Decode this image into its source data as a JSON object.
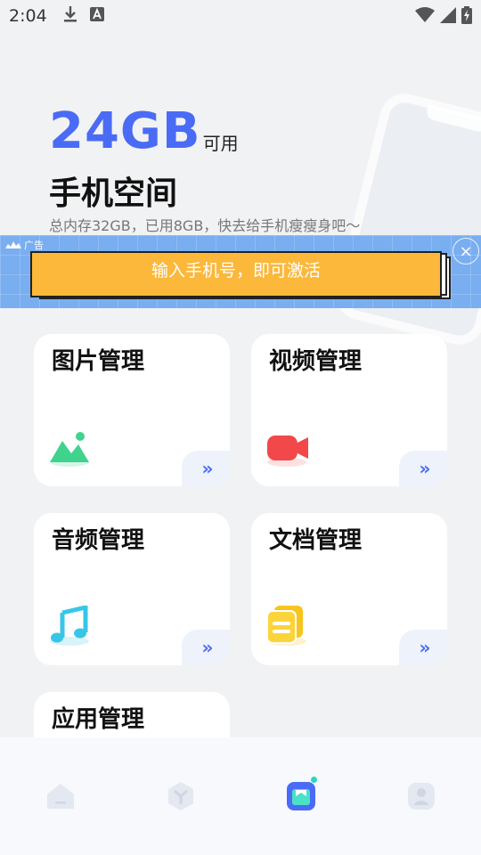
{
  "status_bar": {
    "time": "2:04",
    "icons": [
      "download-icon",
      "a-text-icon",
      "wifi-icon",
      "signal-icon",
      "battery-charging-icon"
    ]
  },
  "hero": {
    "storage_value": "24GB",
    "storage_unit": "可用",
    "title": "手机空间",
    "subtitle": "总内存32GB，已用8GB，快去给手机瘦瘦身吧〜"
  },
  "ad": {
    "tag": "广告",
    "button_label": "输入手机号，即可激活",
    "close": "×",
    "colors": {
      "background": "#79aef0",
      "button": "#fbb83a"
    }
  },
  "cards": [
    {
      "label": "图片管理",
      "icon": "picture-icon",
      "arrow": "»"
    },
    {
      "label": "视频管理",
      "icon": "video-camera-icon",
      "arrow": "»"
    },
    {
      "label": "音频管理",
      "icon": "music-note-icon",
      "arrow": "»"
    },
    {
      "label": "文档管理",
      "icon": "document-icon",
      "arrow": "»"
    },
    {
      "label": "应用管理",
      "icon": "apps-icon",
      "arrow": "»"
    }
  ],
  "bottom_nav": {
    "items": [
      {
        "icon": "home-icon",
        "active": false
      },
      {
        "icon": "clean-icon",
        "active": false
      },
      {
        "icon": "file-manager-icon",
        "active": true
      },
      {
        "icon": "profile-icon",
        "active": false
      }
    ]
  },
  "colors": {
    "accent": "#4a6bf5",
    "background": "#f1f2f4"
  }
}
